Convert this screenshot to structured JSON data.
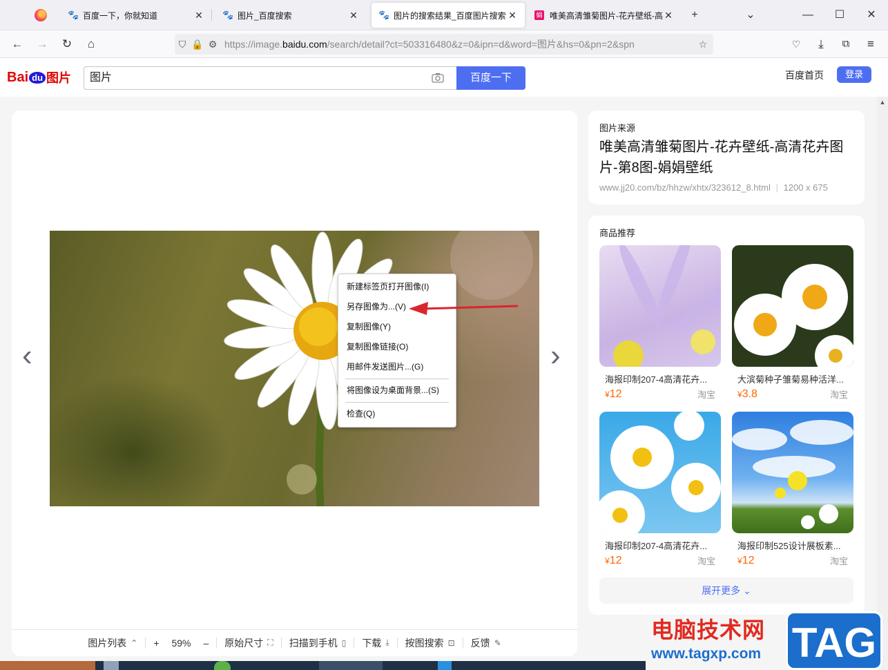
{
  "browser": {
    "tabs": [
      {
        "label": "百度一下，你就知道",
        "active": false,
        "icon": "baidu-paw-icon"
      },
      {
        "label": "图片_百度搜索",
        "active": false,
        "icon": "baidu-paw-icon"
      },
      {
        "label": "图片的搜索结果_百度图片搜索",
        "active": true,
        "icon": "baidu-paw-icon"
      },
      {
        "label": "唯美高清雏菊图片-花卉壁纸-高",
        "active": false,
        "icon": "jj-site-icon"
      }
    ],
    "new_tab": "+",
    "url_prefix": "https://image.",
    "url_domain": "baidu.com",
    "url_rest": "/search/detail?ct=503316480&z=0&ipn=d&word=图片&hs=0&pn=2&spn"
  },
  "baidu": {
    "logo_bai": "Bai",
    "logo_du": "du",
    "logo_suffix": "图片",
    "search_value": "图片",
    "search_button": "百度一下",
    "home_link": "百度首页",
    "login_button": "登录"
  },
  "context_menu": {
    "items": [
      "新建标签页打开图像(I)",
      "另存图像为...(V)",
      "复制图像(Y)",
      "复制图像链接(O)",
      "用邮件发送图片...(G)",
      "将图像设为桌面背景...(S)",
      "检查(Q)"
    ]
  },
  "viewer_toolbar": {
    "list": "图片列表",
    "zoom_in": "+",
    "zoom": "59%",
    "zoom_out": "–",
    "original": "原始尺寸",
    "scan": "扫描到手机",
    "download": "下载",
    "search_by_image": "按图搜索",
    "feedback": "反馈"
  },
  "source": {
    "label": "图片来源",
    "title": "唯美高清雏菊图片-花卉壁纸-高清花卉图片-第8图-娟娟壁纸",
    "url": "www.jj20.com/bz/hhzw/xhtx/323612_8.html",
    "size": "1200 x 675"
  },
  "products": {
    "title": "商品推荐",
    "items": [
      {
        "name": "海报印制207-4高清花卉...",
        "currency": "¥",
        "price": "12",
        "shop": "淘宝"
      },
      {
        "name": "大滨菊种子雏菊易种活洋...",
        "currency": "¥",
        "price": "3.8",
        "shop": "淘宝"
      },
      {
        "name": "海报印制207-4高清花卉...",
        "currency": "¥",
        "price": "12",
        "shop": "淘宝"
      },
      {
        "name": "海报印制525设计展板素...",
        "currency": "¥",
        "price": "12",
        "shop": "淘宝"
      }
    ],
    "more": "展开更多"
  },
  "watermark": {
    "cn": "电脑技术网",
    "url": "www.tagxp.com",
    "tag": "TAG"
  },
  "colors": {
    "accent": "#4e6ef2",
    "price": "#ff6600",
    "arrow": "#d9262c"
  }
}
